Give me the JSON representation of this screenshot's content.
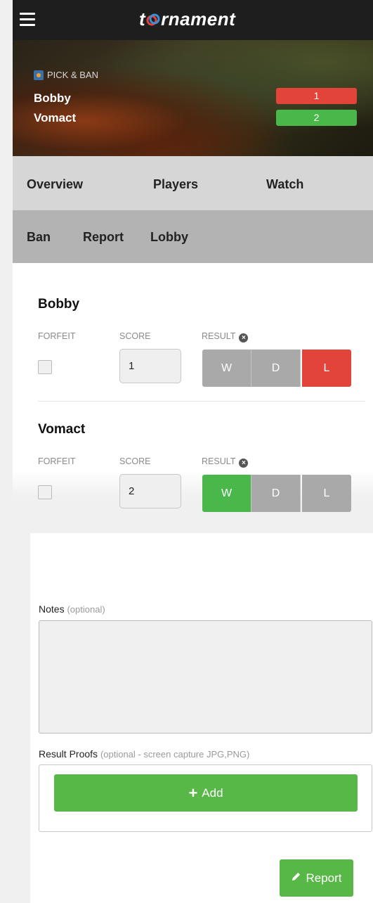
{
  "header": {
    "logo_text_pre": "t",
    "logo_text_post": "rnament"
  },
  "hero": {
    "tag": "PICK & BAN",
    "players": [
      {
        "name": "Bobby",
        "score": "1",
        "color": "#e2443a"
      },
      {
        "name": "Vomact",
        "score": "2",
        "color": "#49b74a"
      }
    ]
  },
  "nav_primary": [
    "Overview",
    "Players",
    "Watch"
  ],
  "nav_secondary": [
    "Ban",
    "Report",
    "Lobby"
  ],
  "report": {
    "col_forfeit": "FORFEIT",
    "col_score": "SCORE",
    "col_result": "RESULT",
    "result_labels": [
      "W",
      "D",
      "L"
    ],
    "players": [
      {
        "name": "Bobby",
        "score": "1",
        "selected": "L"
      },
      {
        "name": "Vomact",
        "score": "2",
        "selected": "W"
      }
    ]
  },
  "notes": {
    "label": "Notes",
    "optional": "(optional)"
  },
  "proofs": {
    "label": "Result Proofs",
    "optional": "(optional - screen capture JPG,PNG)",
    "add_label": "Add"
  },
  "report_button": "Report",
  "colors": {
    "win": "#49b74a",
    "loss": "#e2443a",
    "neutral": "#a9a9a9",
    "accent": "#58b847"
  }
}
